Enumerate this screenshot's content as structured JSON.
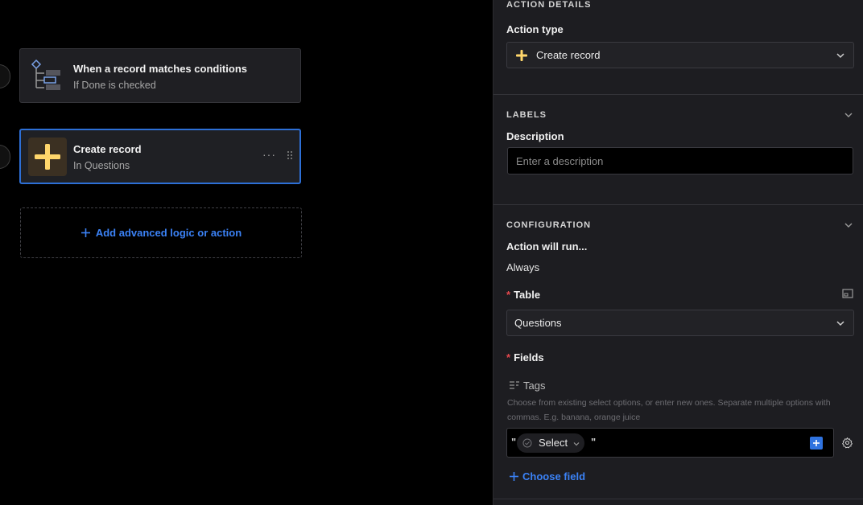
{
  "canvas": {
    "trigger": {
      "title": "When a record matches conditions",
      "subtitle": "If Done is checked",
      "icon": "condition-tree-icon"
    },
    "action": {
      "title": "Create record",
      "subtitle": "In Questions",
      "icon": "plus-icon",
      "more_label": "···"
    },
    "add_label": "Add advanced logic or action"
  },
  "panel": {
    "action_details": {
      "heading": "ACTION DETAILS",
      "type_label": "Action type",
      "type_value": "Create record"
    },
    "labels": {
      "heading": "LABELS",
      "description_label": "Description",
      "description_placeholder": "Enter a description"
    },
    "configuration": {
      "heading": "CONFIGURATION",
      "run_label": "Action will run...",
      "run_value": "Always",
      "table_label": "Table",
      "table_value": "Questions",
      "fields_label": "Fields",
      "required_mark": "*",
      "field": {
        "name": "Tags",
        "help": "Choose from existing select options, or enter new ones. Separate multiple options with commas. E.g. banana, orange juice",
        "open_quote": "\"",
        "close_quote": "\"",
        "select_label": "Select"
      },
      "choose_field_label": "Choose field"
    }
  },
  "colors": {
    "accent": "#3b82f6",
    "selected_border": "#2d6fd6",
    "plus_yellow": "#ffd66b",
    "required": "#e5484d"
  }
}
